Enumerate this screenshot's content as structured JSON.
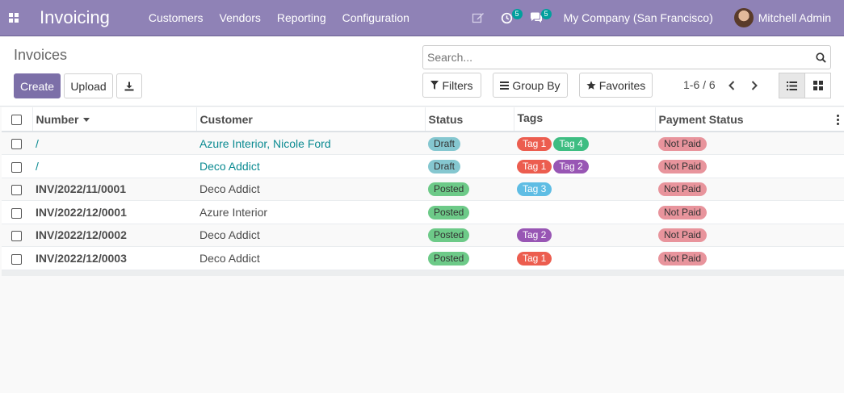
{
  "navbar": {
    "app_name": "Invoicing",
    "menu": [
      "Customers",
      "Vendors",
      "Reporting",
      "Configuration"
    ],
    "activity_count": "5",
    "messages_count": "5",
    "company": "My Company (San Francisco)",
    "user": "Mitchell Admin"
  },
  "control_panel": {
    "title": "Invoices",
    "create_label": "Create",
    "upload_label": "Upload",
    "search_placeholder": "Search...",
    "filters_label": "Filters",
    "groupby_label": "Group By",
    "favorites_label": "Favorites",
    "pager": "1-6 / 6"
  },
  "table": {
    "columns": [
      "Number",
      "Customer",
      "Status",
      "Tags",
      "Payment Status"
    ],
    "rows": [
      {
        "number": "/",
        "customer": "Azure Interior, Nicole Ford",
        "status": "Draft",
        "tags": [
          "Tag 1",
          "Tag 4"
        ],
        "payment": "Not Paid"
      },
      {
        "number": "/",
        "customer": "Deco Addict",
        "status": "Draft",
        "tags": [
          "Tag 1",
          "Tag 2"
        ],
        "payment": "Not Paid"
      },
      {
        "number": "INV/2022/11/0001",
        "customer": "Deco Addict",
        "status": "Posted",
        "tags": [
          "Tag 3"
        ],
        "payment": "Not Paid"
      },
      {
        "number": "INV/2022/12/0001",
        "customer": "Azure Interior",
        "status": "Posted",
        "tags": [],
        "payment": "Not Paid"
      },
      {
        "number": "INV/2022/12/0002",
        "customer": "Deco Addict",
        "status": "Posted",
        "tags": [
          "Tag 2"
        ],
        "payment": "Not Paid"
      },
      {
        "number": "INV/2022/12/0003",
        "customer": "Deco Addict",
        "status": "Posted",
        "tags": [
          "Tag 1"
        ],
        "payment": "Not Paid"
      }
    ]
  },
  "colors": {
    "navbar": "#8f82b6",
    "primary_button": "#7c6fa8",
    "link": "#0a8a91",
    "status_draft": "#85c7d0",
    "status_posted": "#6dca88",
    "not_paid": "#e8949c",
    "tag_1": "#ec5d4f",
    "tag_2": "#9856b4",
    "tag_3": "#5fbde4",
    "tag_4": "#3ebd82"
  },
  "icons": [
    "apps-grid-icon",
    "edit-icon",
    "activity-clock-icon",
    "chat-bubble-icon",
    "search-icon",
    "download-icon",
    "filter-icon",
    "list-bars-icon",
    "star-icon",
    "chevron-left-icon",
    "chevron-right-icon",
    "list-view-icon",
    "kanban-view-icon",
    "column-options-icon"
  ]
}
